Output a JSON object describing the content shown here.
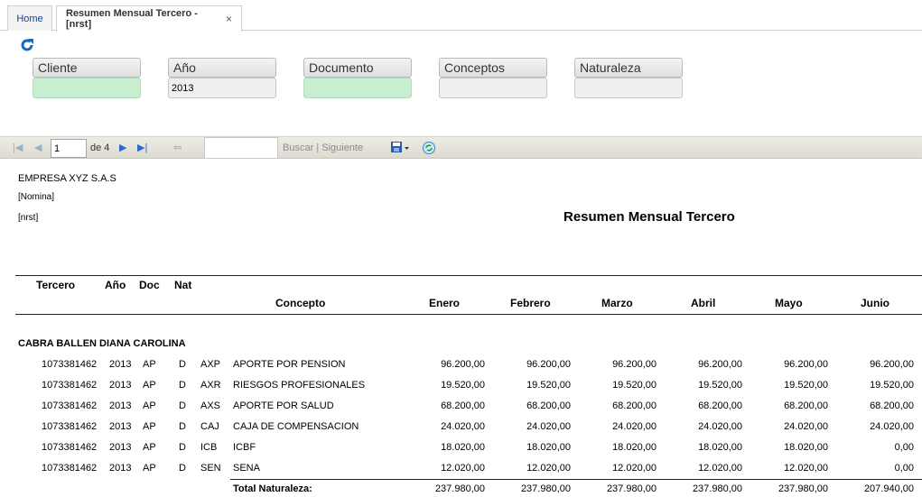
{
  "tabs": [
    {
      "label": "Home"
    },
    {
      "label": "Resumen Mensual Tercero -[nrst]",
      "close": "×"
    }
  ],
  "filters": [
    {
      "label": "Cliente",
      "value": ""
    },
    {
      "label": "Año",
      "value": "2013"
    },
    {
      "label": "Documento",
      "value": ""
    },
    {
      "label": "Conceptos",
      "value": ""
    },
    {
      "label": "Naturaleza",
      "value": ""
    }
  ],
  "toolbar": {
    "page": "1",
    "of_label": "de 4",
    "search_label": "Buscar",
    "separator": "|",
    "next_label": "Siguiente"
  },
  "report": {
    "company": "EMPRESA XYZ S.A.S",
    "group": "[Nomina]",
    "code": "[nrst]",
    "title": "Resumen Mensual Tercero",
    "columns": {
      "tercero": "Tercero",
      "anio": "Año",
      "doc": "Doc",
      "nat": "Nat",
      "concepto": "Concepto",
      "enero": "Enero",
      "febrero": "Febrero",
      "marzo": "Marzo",
      "abril": "Abril",
      "mayo": "Mayo",
      "junio": "Junio"
    },
    "person": "CABRA BALLEN DIANA CAROLINA",
    "rows": [
      {
        "tercero": "1073381462",
        "anio": "2013",
        "doc": "AP",
        "nat": "D",
        "cod": "AXP",
        "concepto": "APORTE POR PENSION",
        "enero": "96.200,00",
        "febrero": "96.200,00",
        "marzo": "96.200,00",
        "abril": "96.200,00",
        "mayo": "96.200,00",
        "junio": "96.200,00"
      },
      {
        "tercero": "1073381462",
        "anio": "2013",
        "doc": "AP",
        "nat": "D",
        "cod": "AXR",
        "concepto": "RIESGOS PROFESIONALES",
        "enero": "19.520,00",
        "febrero": "19.520,00",
        "marzo": "19.520,00",
        "abril": "19.520,00",
        "mayo": "19.520,00",
        "junio": "19.520,00"
      },
      {
        "tercero": "1073381462",
        "anio": "2013",
        "doc": "AP",
        "nat": "D",
        "cod": "AXS",
        "concepto": "APORTE POR SALUD",
        "enero": "68.200,00",
        "febrero": "68.200,00",
        "marzo": "68.200,00",
        "abril": "68.200,00",
        "mayo": "68.200,00",
        "junio": "68.200,00"
      },
      {
        "tercero": "1073381462",
        "anio": "2013",
        "doc": "AP",
        "nat": "D",
        "cod": "CAJ",
        "concepto": "CAJA DE COMPENSACION",
        "enero": "24.020,00",
        "febrero": "24.020,00",
        "marzo": "24.020,00",
        "abril": "24.020,00",
        "mayo": "24.020,00",
        "junio": "24.020,00"
      },
      {
        "tercero": "1073381462",
        "anio": "2013",
        "doc": "AP",
        "nat": "D",
        "cod": "ICB",
        "concepto": "ICBF",
        "enero": "18.020,00",
        "febrero": "18.020,00",
        "marzo": "18.020,00",
        "abril": "18.020,00",
        "mayo": "18.020,00",
        "junio": "0,00"
      },
      {
        "tercero": "1073381462",
        "anio": "2013",
        "doc": "AP",
        "nat": "D",
        "cod": "SEN",
        "concepto": "SENA",
        "enero": "12.020,00",
        "febrero": "12.020,00",
        "marzo": "12.020,00",
        "abril": "12.020,00",
        "mayo": "12.020,00",
        "junio": "0,00"
      }
    ],
    "total": {
      "label": "Total Naturaleza:",
      "enero": "237.980,00",
      "febrero": "237.980,00",
      "marzo": "237.980,00",
      "abril": "237.980,00",
      "mayo": "237.980,00",
      "junio": "207.940,00"
    }
  },
  "colors": {
    "accent": "#15428b",
    "green_field": "#c7efcf",
    "toolbar": "#e6e4dc"
  },
  "icons": [
    "refresh-icon",
    "first-page-icon",
    "prev-page-icon",
    "next-page-icon",
    "last-page-icon",
    "back-icon",
    "save-icon",
    "refresh-report-icon"
  ]
}
